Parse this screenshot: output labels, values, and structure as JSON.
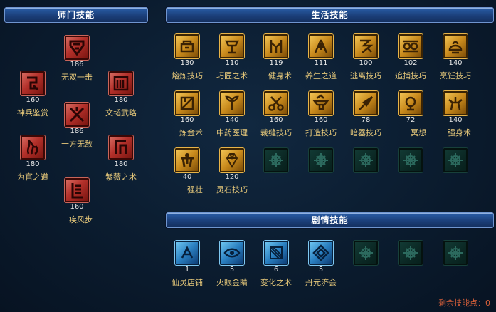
{
  "sections": {
    "school": "师门技能",
    "life": "生活技能",
    "story": "剧情技能"
  },
  "school_skills": [
    {
      "name": "无双一击",
      "level": "186"
    },
    {
      "name": "神兵鉴赏",
      "level": "160"
    },
    {
      "name": "文韬武略",
      "level": "180"
    },
    {
      "name": "十方无敌",
      "level": "186"
    },
    {
      "name": "为官之道",
      "level": "180"
    },
    {
      "name": "紫薇之术",
      "level": "180"
    },
    {
      "name": "疾风步",
      "level": "160"
    }
  ],
  "life_skills": [
    {
      "name": "熔炼技巧",
      "level": "130"
    },
    {
      "name": "巧匠之术",
      "level": "110"
    },
    {
      "name": "健身术",
      "level": "119"
    },
    {
      "name": "养生之道",
      "level": "111"
    },
    {
      "name": "逃离技巧",
      "level": "100"
    },
    {
      "name": "追捕技巧",
      "level": "102"
    },
    {
      "name": "烹饪技巧",
      "level": "140"
    },
    {
      "name": "炼金术",
      "level": "160"
    },
    {
      "name": "中药医理",
      "level": "140"
    },
    {
      "name": "裁缝技巧",
      "level": "160"
    },
    {
      "name": "打造技巧",
      "level": "160"
    },
    {
      "name": "暗器技巧",
      "level": "78"
    },
    {
      "name": "冥想",
      "level": "72"
    },
    {
      "name": "强身术",
      "level": "140"
    },
    {
      "name": "强壮",
      "level": "40"
    },
    {
      "name": "灵石技巧",
      "level": "120"
    }
  ],
  "story_skills": [
    {
      "name": "仙灵店铺",
      "level": "1"
    },
    {
      "name": "火眼金睛",
      "level": "5"
    },
    {
      "name": "变化之术",
      "level": "6"
    },
    {
      "name": "丹元济会",
      "level": "5"
    }
  ],
  "footer": {
    "label": "剩余技能点：",
    "value": "0"
  }
}
